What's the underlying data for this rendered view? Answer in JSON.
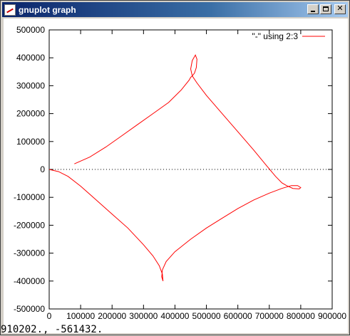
{
  "window": {
    "title": "gnuplot graph",
    "icon": "gnuplot-icon",
    "controls": [
      "minimize-icon",
      "maximize-icon",
      "close-icon"
    ]
  },
  "statusbar": {
    "coords": "910202., -561432."
  },
  "chart_data": {
    "type": "line",
    "title": "",
    "xlabel": "",
    "ylabel": "",
    "xlim": [
      0,
      900000
    ],
    "ylim": [
      -500000,
      500000
    ],
    "xticks": [
      0,
      100000,
      200000,
      300000,
      400000,
      500000,
      600000,
      700000,
      800000,
      900000
    ],
    "yticks": [
      500000,
      400000,
      300000,
      200000,
      100000,
      0,
      -100000,
      -200000,
      -300000,
      -400000,
      -500000
    ],
    "legend": {
      "position": "top-right"
    },
    "grid": false,
    "series": [
      {
        "name": "\"-\" using 2:3",
        "color": "#ff0000",
        "x": [
          0,
          30000,
          60000,
          100000,
          150000,
          200000,
          250000,
          300000,
          330000,
          350000,
          360000,
          362000,
          358000,
          360000,
          372000,
          400000,
          450000,
          500000,
          550000,
          600000,
          650000,
          700000,
          740000,
          770000,
          790000,
          800000,
          795000,
          775000,
          755000,
          740000,
          720000,
          690000,
          650000,
          600000,
          550000,
          500000,
          470000,
          455000,
          450000,
          455000,
          465000,
          470000,
          468000,
          462000,
          455000,
          450000,
          445000,
          420000,
          380000,
          330000,
          280000,
          230000,
          180000,
          130000,
          80000
        ],
        "y": [
          0,
          -8000,
          -25000,
          -60000,
          -110000,
          -160000,
          -210000,
          -270000,
          -310000,
          -345000,
          -375000,
          -400000,
          -385000,
          -360000,
          -330000,
          -295000,
          -250000,
          -210000,
          -175000,
          -140000,
          -110000,
          -85000,
          -68000,
          -58000,
          -58000,
          -65000,
          -70000,
          -68000,
          -58000,
          -48000,
          -25000,
          15000,
          70000,
          135000,
          200000,
          265000,
          310000,
          335000,
          360000,
          390000,
          410000,
          395000,
          365000,
          345000,
          335000,
          330000,
          320000,
          285000,
          240000,
          200000,
          160000,
          120000,
          80000,
          45000,
          20000
        ]
      }
    ]
  }
}
